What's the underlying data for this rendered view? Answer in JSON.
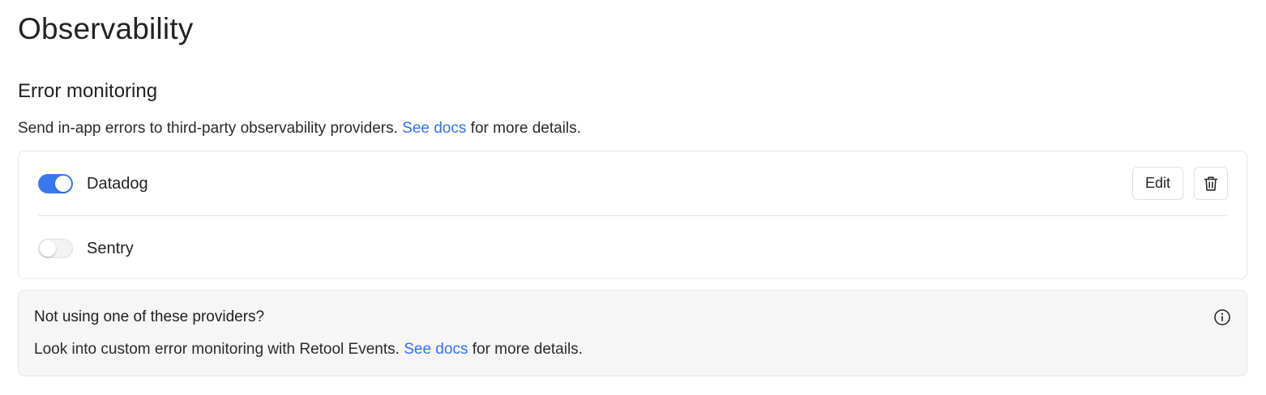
{
  "page": {
    "title": "Observability"
  },
  "error_monitoring": {
    "title": "Error monitoring",
    "description_before": "Send in-app errors to third-party observability providers. ",
    "description_link": "See docs",
    "description_after": " for more details.",
    "providers": [
      {
        "name": "Datadog",
        "enabled": true,
        "edit_label": "Edit",
        "delete_icon": "trash-icon"
      },
      {
        "name": "Sentry",
        "enabled": false
      }
    ]
  },
  "info_card": {
    "title": "Not using one of these providers?",
    "text_before": "Look into custom error monitoring with Retool Events. ",
    "text_link": "See docs",
    "text_after": " for more details.",
    "icon": "info-icon"
  },
  "colors": {
    "accent": "#3a78f2",
    "link": "#3170f5",
    "info_card_bg": "#f6f6f6"
  }
}
